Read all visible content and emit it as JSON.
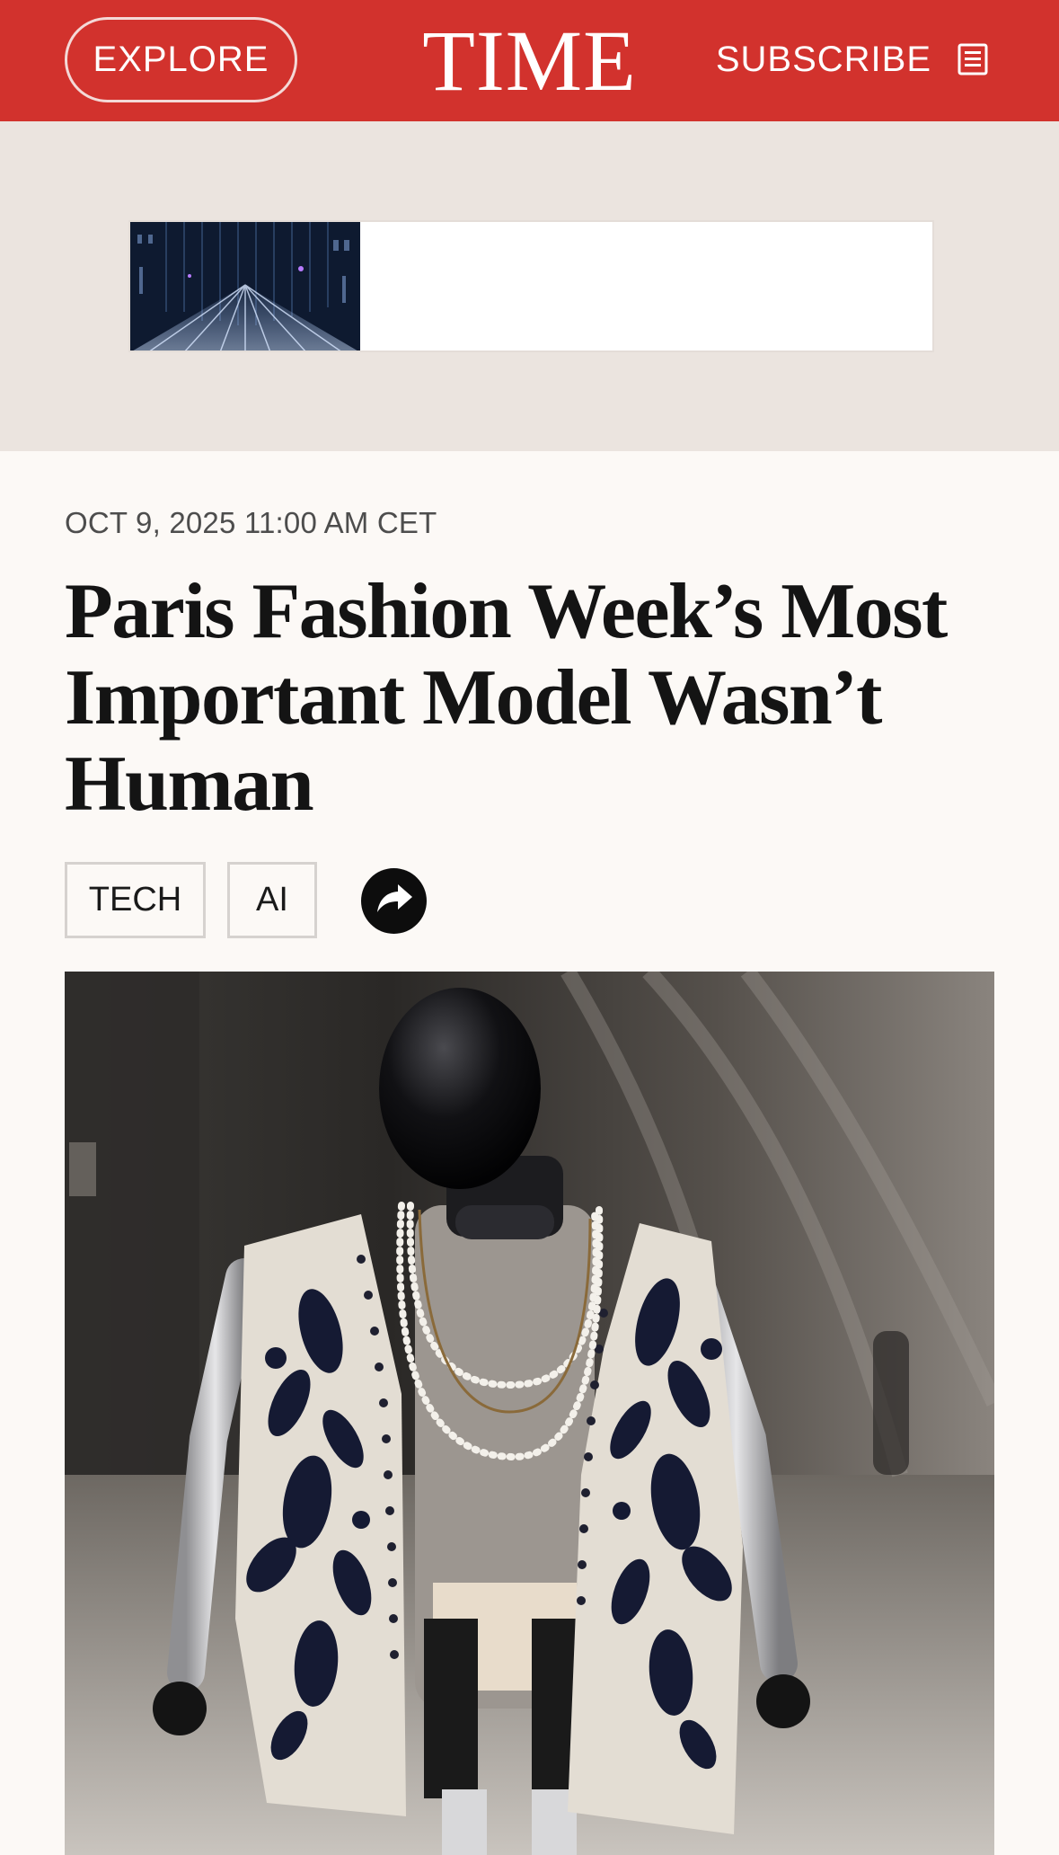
{
  "header": {
    "explore_label": "EXPLORE",
    "logo_text": "TIME",
    "subscribe_label": "SUBSCRIBE",
    "menu_icon": "newspaper-icon",
    "background": "#d2322d"
  },
  "ad": {
    "background": "#ebe4df"
  },
  "article": {
    "dateline": "OCT 9, 2025 11:00 AM CET",
    "headline": "Paris Fashion Week’s Most Important Model Wasn’t Human",
    "tags": [
      "TECH",
      "AI"
    ],
    "share_icon": "share-arrow-icon"
  }
}
